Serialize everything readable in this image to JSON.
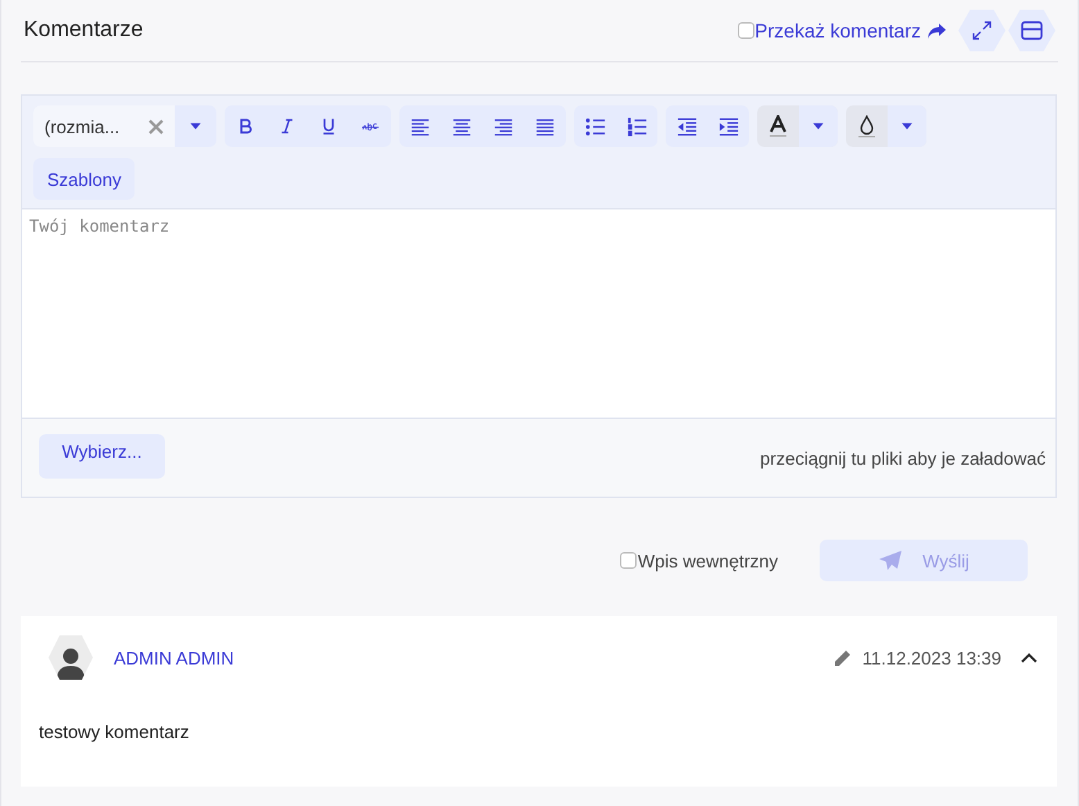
{
  "header": {
    "title": "Komentarze",
    "forward": {
      "label": "Przekaż komentarz",
      "checked": false
    }
  },
  "toolbar": {
    "font_size": {
      "value": "(rozmia..."
    },
    "templates_button": "Szablony"
  },
  "editor": {
    "placeholder": "Twój komentarz"
  },
  "upload": {
    "button": "Wybierz...",
    "hint": "przeciągnij tu pliki aby je załadować"
  },
  "internal": {
    "label": "Wpis wewnętrzny",
    "checked": false
  },
  "send_button": {
    "label": "Wyślij",
    "disabled": true
  },
  "comments": [
    {
      "author": "ADMIN ADMIN",
      "date": "11.12.2023 13:39",
      "text": "testowy komentarz",
      "expanded": true
    }
  ]
}
